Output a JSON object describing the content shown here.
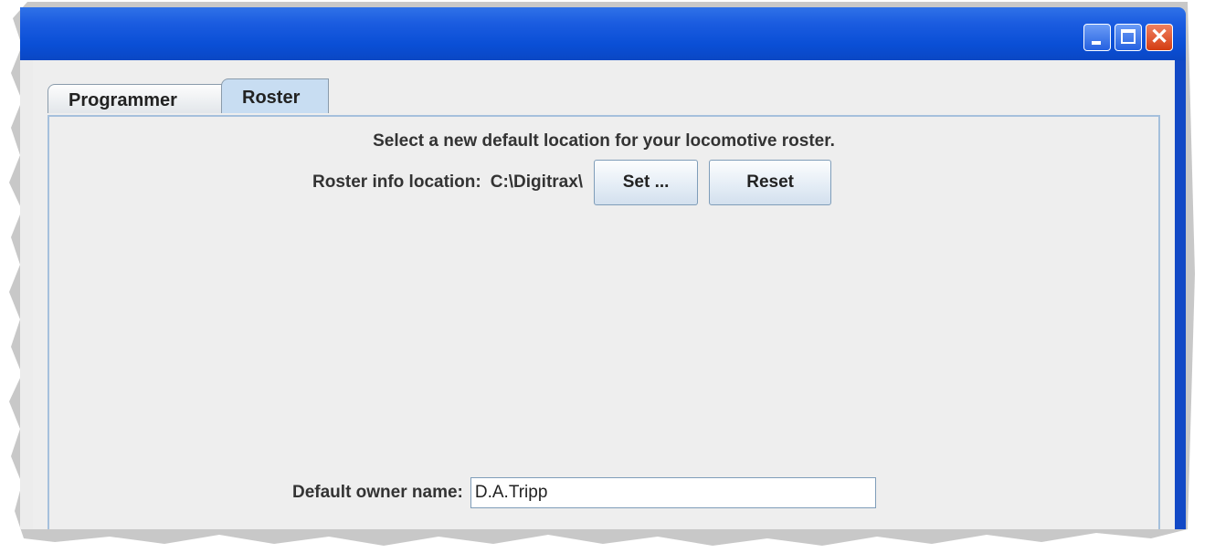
{
  "tabs": [
    {
      "label": "Programmer"
    },
    {
      "label": "Roster"
    }
  ],
  "roster_panel": {
    "heading": "Select a new default location for your locomotive roster.",
    "location_label": "Roster info location:",
    "location_value": "C:\\Digitrax\\",
    "set_button": "Set ...",
    "reset_button": "Reset",
    "owner_label": "Default owner name:",
    "owner_value": "D.A.Tripp"
  },
  "window_controls": [
    "minimize-icon",
    "maximize-icon",
    "close-icon"
  ],
  "colors": {
    "titlebar": "#0a4fd6",
    "active_tab": "#c8ddf2",
    "panel_border": "#a5c0dc"
  }
}
